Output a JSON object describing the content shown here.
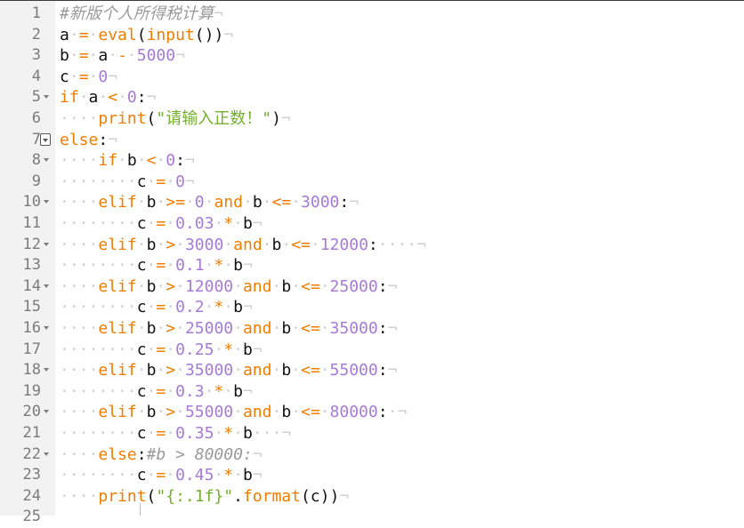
{
  "editor": {
    "lines": [
      {
        "n": "1",
        "fold": "",
        "tokens": [
          [
            "cm",
            "#新版个人所得税计算"
          ],
          [
            "ws",
            "¬"
          ]
        ]
      },
      {
        "n": "2",
        "fold": "",
        "tokens": [
          [
            "id",
            "a"
          ],
          [
            "ws",
            "·"
          ],
          [
            "op",
            "="
          ],
          [
            "ws",
            "·"
          ],
          [
            "fn",
            "eval"
          ],
          [
            "id",
            "("
          ],
          [
            "fn",
            "input"
          ],
          [
            "id",
            "())"
          ],
          [
            "ws",
            "¬"
          ]
        ]
      },
      {
        "n": "3",
        "fold": "",
        "tokens": [
          [
            "id",
            "b"
          ],
          [
            "ws",
            "·"
          ],
          [
            "op",
            "="
          ],
          [
            "ws",
            "·"
          ],
          [
            "id",
            "a"
          ],
          [
            "ws",
            "·"
          ],
          [
            "op",
            "-"
          ],
          [
            "ws",
            "·"
          ],
          [
            "num",
            "5000"
          ],
          [
            "ws",
            "¬"
          ]
        ]
      },
      {
        "n": "4",
        "fold": "",
        "tokens": [
          [
            "id",
            "c"
          ],
          [
            "ws",
            "·"
          ],
          [
            "op",
            "="
          ],
          [
            "ws",
            "·"
          ],
          [
            "num",
            "0"
          ],
          [
            "ws",
            "¬"
          ]
        ]
      },
      {
        "n": "5",
        "fold": "arrow",
        "tokens": [
          [
            "kw",
            "if"
          ],
          [
            "ws",
            "·"
          ],
          [
            "id",
            "a"
          ],
          [
            "ws",
            "·"
          ],
          [
            "op",
            "<"
          ],
          [
            "ws",
            "·"
          ],
          [
            "num",
            "0"
          ],
          [
            "id",
            ":"
          ],
          [
            "ws",
            "¬"
          ]
        ]
      },
      {
        "n": "6",
        "fold": "",
        "tokens": [
          [
            "ws",
            "····"
          ],
          [
            "fn",
            "print"
          ],
          [
            "id",
            "("
          ],
          [
            "str",
            "\"请输入正数！\""
          ],
          [
            "id",
            ")"
          ],
          [
            "ws",
            "¬"
          ]
        ]
      },
      {
        "n": "7",
        "fold": "box",
        "tokens": [
          [
            "kw",
            "else"
          ],
          [
            "id",
            ":"
          ],
          [
            "ws",
            "¬"
          ]
        ]
      },
      {
        "n": "8",
        "fold": "arrow",
        "tokens": [
          [
            "ws",
            "····"
          ],
          [
            "kw",
            "if"
          ],
          [
            "ws",
            "·"
          ],
          [
            "id",
            "b"
          ],
          [
            "ws",
            "·"
          ],
          [
            "op",
            "<"
          ],
          [
            "ws",
            "·"
          ],
          [
            "num",
            "0"
          ],
          [
            "id",
            ":"
          ],
          [
            "ws",
            "¬"
          ]
        ]
      },
      {
        "n": "9",
        "fold": "",
        "tokens": [
          [
            "ws",
            "········"
          ],
          [
            "id",
            "c"
          ],
          [
            "ws",
            "·"
          ],
          [
            "op",
            "="
          ],
          [
            "ws",
            "·"
          ],
          [
            "num",
            "0"
          ],
          [
            "ws",
            "¬"
          ]
        ]
      },
      {
        "n": "10",
        "fold": "arrow",
        "tokens": [
          [
            "ws",
            "····"
          ],
          [
            "kw",
            "elif"
          ],
          [
            "ws",
            "·"
          ],
          [
            "id",
            "b"
          ],
          [
            "ws",
            "·"
          ],
          [
            "op",
            ">="
          ],
          [
            "ws",
            "·"
          ],
          [
            "num",
            "0"
          ],
          [
            "ws",
            "·"
          ],
          [
            "kw",
            "and"
          ],
          [
            "ws",
            "·"
          ],
          [
            "id",
            "b"
          ],
          [
            "ws",
            "·"
          ],
          [
            "op",
            "<="
          ],
          [
            "ws",
            "·"
          ],
          [
            "num",
            "3000"
          ],
          [
            "id",
            ":"
          ],
          [
            "ws",
            "¬"
          ]
        ]
      },
      {
        "n": "11",
        "fold": "",
        "tokens": [
          [
            "ws",
            "········"
          ],
          [
            "id",
            "c"
          ],
          [
            "ws",
            "·"
          ],
          [
            "op",
            "="
          ],
          [
            "ws",
            "·"
          ],
          [
            "num",
            "0.03"
          ],
          [
            "ws",
            "·"
          ],
          [
            "op",
            "*"
          ],
          [
            "ws",
            "·"
          ],
          [
            "id",
            "b"
          ],
          [
            "ws",
            "¬"
          ]
        ]
      },
      {
        "n": "12",
        "fold": "arrow",
        "tokens": [
          [
            "ws",
            "····"
          ],
          [
            "kw",
            "elif"
          ],
          [
            "ws",
            "·"
          ],
          [
            "id",
            "b"
          ],
          [
            "ws",
            "·"
          ],
          [
            "op",
            ">"
          ],
          [
            "ws",
            "·"
          ],
          [
            "num",
            "3000"
          ],
          [
            "ws",
            "·"
          ],
          [
            "kw",
            "and"
          ],
          [
            "ws",
            "·"
          ],
          [
            "id",
            "b"
          ],
          [
            "ws",
            "·"
          ],
          [
            "op",
            "<="
          ],
          [
            "ws",
            "·"
          ],
          [
            "num",
            "12000"
          ],
          [
            "id",
            ":"
          ],
          [
            "ws",
            "····¬"
          ]
        ]
      },
      {
        "n": "13",
        "fold": "",
        "tokens": [
          [
            "ws",
            "········"
          ],
          [
            "id",
            "c"
          ],
          [
            "ws",
            "·"
          ],
          [
            "op",
            "="
          ],
          [
            "ws",
            "·"
          ],
          [
            "num",
            "0.1"
          ],
          [
            "ws",
            "·"
          ],
          [
            "op",
            "*"
          ],
          [
            "ws",
            "·"
          ],
          [
            "id",
            "b"
          ],
          [
            "ws",
            "¬"
          ]
        ]
      },
      {
        "n": "14",
        "fold": "arrow",
        "tokens": [
          [
            "ws",
            "····"
          ],
          [
            "kw",
            "elif"
          ],
          [
            "ws",
            "·"
          ],
          [
            "id",
            "b"
          ],
          [
            "ws",
            "·"
          ],
          [
            "op",
            ">"
          ],
          [
            "ws",
            "·"
          ],
          [
            "num",
            "12000"
          ],
          [
            "ws",
            "·"
          ],
          [
            "kw",
            "and"
          ],
          [
            "ws",
            "·"
          ],
          [
            "id",
            "b"
          ],
          [
            "ws",
            "·"
          ],
          [
            "op",
            "<="
          ],
          [
            "ws",
            "·"
          ],
          [
            "num",
            "25000"
          ],
          [
            "id",
            ":"
          ],
          [
            "ws",
            "¬"
          ]
        ]
      },
      {
        "n": "15",
        "fold": "",
        "tokens": [
          [
            "ws",
            "········"
          ],
          [
            "id",
            "c"
          ],
          [
            "ws",
            "·"
          ],
          [
            "op",
            "="
          ],
          [
            "ws",
            "·"
          ],
          [
            "num",
            "0.2"
          ],
          [
            "ws",
            "·"
          ],
          [
            "op",
            "*"
          ],
          [
            "ws",
            "·"
          ],
          [
            "id",
            "b"
          ],
          [
            "ws",
            "¬"
          ]
        ]
      },
      {
        "n": "16",
        "fold": "arrow",
        "tokens": [
          [
            "ws",
            "····"
          ],
          [
            "kw",
            "elif"
          ],
          [
            "ws",
            "·"
          ],
          [
            "id",
            "b"
          ],
          [
            "ws",
            "·"
          ],
          [
            "op",
            ">"
          ],
          [
            "ws",
            "·"
          ],
          [
            "num",
            "25000"
          ],
          [
            "ws",
            "·"
          ],
          [
            "kw",
            "and"
          ],
          [
            "ws",
            "·"
          ],
          [
            "id",
            "b"
          ],
          [
            "ws",
            "·"
          ],
          [
            "op",
            "<="
          ],
          [
            "ws",
            "·"
          ],
          [
            "num",
            "35000"
          ],
          [
            "id",
            ":"
          ],
          [
            "ws",
            "¬"
          ]
        ]
      },
      {
        "n": "17",
        "fold": "",
        "tokens": [
          [
            "ws",
            "········"
          ],
          [
            "id",
            "c"
          ],
          [
            "ws",
            "·"
          ],
          [
            "op",
            "="
          ],
          [
            "ws",
            "·"
          ],
          [
            "num",
            "0.25"
          ],
          [
            "ws",
            "·"
          ],
          [
            "op",
            "*"
          ],
          [
            "ws",
            "·"
          ],
          [
            "id",
            "b"
          ],
          [
            "ws",
            "¬"
          ]
        ]
      },
      {
        "n": "18",
        "fold": "arrow",
        "tokens": [
          [
            "ws",
            "····"
          ],
          [
            "kw",
            "elif"
          ],
          [
            "ws",
            "·"
          ],
          [
            "id",
            "b"
          ],
          [
            "ws",
            "·"
          ],
          [
            "op",
            ">"
          ],
          [
            "ws",
            "·"
          ],
          [
            "num",
            "35000"
          ],
          [
            "ws",
            "·"
          ],
          [
            "kw",
            "and"
          ],
          [
            "ws",
            "·"
          ],
          [
            "id",
            "b"
          ],
          [
            "ws",
            "·"
          ],
          [
            "op",
            "<="
          ],
          [
            "ws",
            "·"
          ],
          [
            "num",
            "55000"
          ],
          [
            "id",
            ":"
          ],
          [
            "ws",
            "¬"
          ]
        ]
      },
      {
        "n": "19",
        "fold": "",
        "tokens": [
          [
            "ws",
            "········"
          ],
          [
            "id",
            "c"
          ],
          [
            "ws",
            "·"
          ],
          [
            "op",
            "="
          ],
          [
            "ws",
            "·"
          ],
          [
            "num",
            "0.3"
          ],
          [
            "ws",
            "·"
          ],
          [
            "op",
            "*"
          ],
          [
            "ws",
            "·"
          ],
          [
            "id",
            "b"
          ],
          [
            "ws",
            "¬"
          ]
        ]
      },
      {
        "n": "20",
        "fold": "arrow",
        "tokens": [
          [
            "ws",
            "····"
          ],
          [
            "kw",
            "elif"
          ],
          [
            "ws",
            "·"
          ],
          [
            "id",
            "b"
          ],
          [
            "ws",
            "·"
          ],
          [
            "op",
            ">"
          ],
          [
            "ws",
            "·"
          ],
          [
            "num",
            "55000"
          ],
          [
            "ws",
            "·"
          ],
          [
            "kw",
            "and"
          ],
          [
            "ws",
            "·"
          ],
          [
            "id",
            "b"
          ],
          [
            "ws",
            "·"
          ],
          [
            "op",
            "<="
          ],
          [
            "ws",
            "·"
          ],
          [
            "num",
            "80000"
          ],
          [
            "id",
            ":"
          ],
          [
            "ws",
            "·¬"
          ]
        ]
      },
      {
        "n": "21",
        "fold": "",
        "tokens": [
          [
            "ws",
            "········"
          ],
          [
            "id",
            "c"
          ],
          [
            "ws",
            "·"
          ],
          [
            "op",
            "="
          ],
          [
            "ws",
            "·"
          ],
          [
            "num",
            "0.35"
          ],
          [
            "ws",
            "·"
          ],
          [
            "op",
            "*"
          ],
          [
            "ws",
            "·"
          ],
          [
            "id",
            "b"
          ],
          [
            "ws",
            "···¬"
          ]
        ]
      },
      {
        "n": "22",
        "fold": "arrow",
        "tokens": [
          [
            "ws",
            "····"
          ],
          [
            "kw",
            "else"
          ],
          [
            "id",
            ":"
          ],
          [
            "cm",
            "#b > 80000:"
          ],
          [
            "ws",
            "¬"
          ]
        ]
      },
      {
        "n": "23",
        "fold": "",
        "tokens": [
          [
            "ws",
            "········"
          ],
          [
            "id",
            "c"
          ],
          [
            "ws",
            "·"
          ],
          [
            "op",
            "="
          ],
          [
            "ws",
            "·"
          ],
          [
            "num",
            "0.45"
          ],
          [
            "ws",
            "·"
          ],
          [
            "op",
            "*"
          ],
          [
            "ws",
            "·"
          ],
          [
            "id",
            "b"
          ],
          [
            "ws",
            "¬"
          ]
        ]
      },
      {
        "n": "24",
        "fold": "",
        "tokens": [
          [
            "ws",
            "····"
          ],
          [
            "fn",
            "print"
          ],
          [
            "id",
            "("
          ],
          [
            "str",
            "\"{:.1f}\""
          ],
          [
            "id",
            "."
          ],
          [
            "fn",
            "format"
          ],
          [
            "id",
            "(c))"
          ],
          [
            "ws",
            "¬"
          ]
        ]
      },
      {
        "n": "25",
        "fold": "",
        "tokens": []
      }
    ]
  }
}
